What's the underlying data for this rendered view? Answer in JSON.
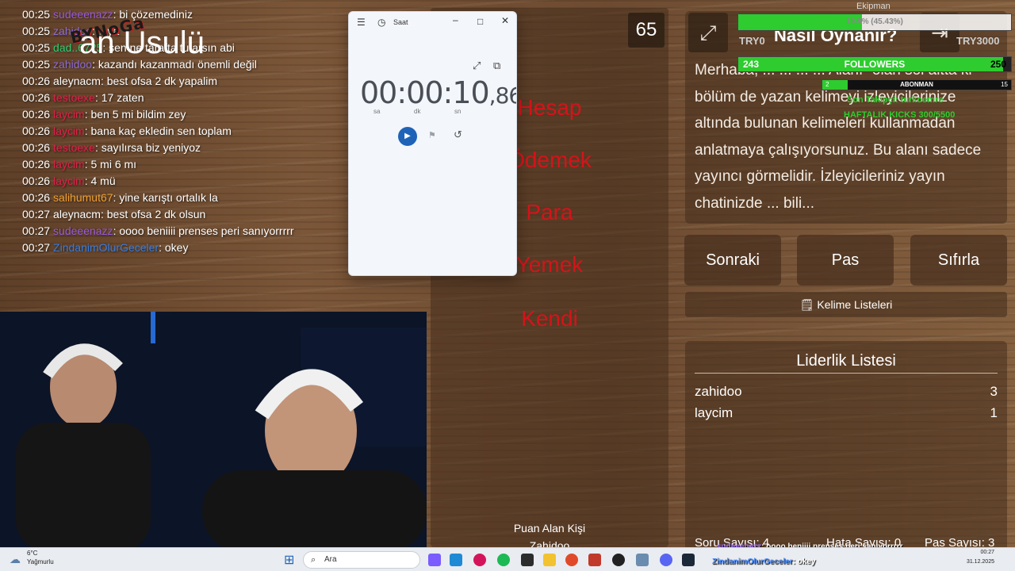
{
  "chat": {
    "messages": [
      {
        "time": "00:25",
        "user": "sudeeenazz",
        "color": "#9b59d9",
        "text": ": bi çözemediniz"
      },
      {
        "time": "00:25",
        "user": "zahidoo",
        "color": "#8e6bd6",
        "text": ": ...ya"
      },
      {
        "time": "00:25",
        "user": "dad..6725",
        "color": "#2ecc71",
        "text": ": sen ne tarafta tutarsın abi"
      },
      {
        "time": "00:25",
        "user": "zahidoo",
        "color": "#8e6bd6",
        "text": ": kazandı kazanmadı önemli değil"
      },
      {
        "time": "00:26",
        "user": "aleynacm",
        "color": "#ffffff",
        "text": ": best ofsa 2 dk yapalim"
      },
      {
        "time": "00:26",
        "user": "testoexe",
        "color": "#e0204a",
        "text": ": 17 zaten"
      },
      {
        "time": "00:26",
        "user": "laycim",
        "color": "#e0204a",
        "text": ": ben 5 mi bildim zey"
      },
      {
        "time": "00:26",
        "user": "laycim",
        "color": "#e0204a",
        "text": ": bana kaç ekledin sen toplam"
      },
      {
        "time": "00:26",
        "user": "testoexe",
        "color": "#e0204a",
        "text": ": sayılırsa biz yeniyoz"
      },
      {
        "time": "00:26",
        "user": "laycim",
        "color": "#e0204a",
        "text": ": 5 mi 6 mı"
      },
      {
        "time": "00:26",
        "user": "laycim",
        "color": "#e0204a",
        "text": ": 4 mü"
      },
      {
        "time": "00:26",
        "user": "salihumut67",
        "color": "#f0a030",
        "text": ": yine karıştı ortalık la"
      },
      {
        "time": "00:27",
        "user": "aleynacm",
        "color": "#ffffff",
        "text": ": best ofsa 2 dk olsun"
      },
      {
        "time": "00:27",
        "user": "sudeeenazz",
        "color": "#9b59d9",
        "text": ": oooo beniiii prenses peri sanıyorrrrr"
      },
      {
        "time": "00:27",
        "user": "ZindanimOlurGeceler",
        "color": "#3b7ddd",
        "text": ": okey"
      }
    ],
    "logo_text": "BYNoGa"
  },
  "clock_app": {
    "title": "Saat",
    "stopwatch_main": "00:00:10",
    "stopwatch_ms": ",86",
    "unit_hours": "sa",
    "unit_minutes": "dk",
    "unit_seconds": "sn"
  },
  "game": {
    "title": "an Usulü",
    "timer": "65",
    "forbidden_words": [
      "Hesap",
      "Ödemek",
      "Para",
      "Yemek",
      "Kendi"
    ],
    "last_scorer_label": "Puan Alan Kişi",
    "last_scorer_name": "Zahidoo"
  },
  "rules": {
    "title": "Nasıl Oynanır?",
    "text": "Merhaba, ... ... ... ... Alanı- olan sol altta ki bölüm de yazan kelimeyi izleyicilerinize altında bulunan kelimeleri kullanmadan anlatmaya çalışıyorsunuz. Bu alanı sadece yayıncı görmelidir. İzleyicileriniz yayın chatinizde ... bili..."
  },
  "controls": {
    "next": "Sonraki",
    "pass": "Pas",
    "reset": "Sıfırla",
    "word_lists": "Kelime Listeleri"
  },
  "leaderboard": {
    "title": "Liderlik Listesi",
    "rows": [
      {
        "name": "zahidoo",
        "score": "3"
      },
      {
        "name": "laycim",
        "score": "1"
      }
    ]
  },
  "stats": {
    "correct": "Soru Sayısı: 4",
    "wrong": "Hata Sayısı: 0",
    "passes": "Pas Sayısı: 3"
  },
  "overlay": {
    "goal_label": "Ekipman",
    "goal_progress_text": "10.9% (45.43%)",
    "goal_percent": 45.43,
    "followers_label": "FOLLOWERS",
    "followers_current": "243",
    "followers_target": "250",
    "followers_fraction": 0.972,
    "subs_label": "ABONMAN",
    "subs_current": "2",
    "subs_target": "15",
    "subs_fraction": 0.133,
    "last_follower": "Son Takipçi: turkoemre",
    "weekly_kicks": "HAFTALIK KICKS 300/5500",
    "currency_left": "TRY0",
    "currency_right": "TRY3000"
  },
  "bottom_chat": [
    {
      "user": "sudeeenazz",
      "text": ": oooo beniiii prenses peri sanıyorrrrr"
    },
    {
      "user": "ZindanimOlurGeceler",
      "text": ": okey"
    }
  ],
  "taskbar": {
    "weather_temp": "6°C",
    "weather_cond": "Yağmurlu",
    "search_placeholder": "Ara",
    "time": "00:27",
    "date": "31.12.2025"
  },
  "colors": {
    "forbidden": "#d4141a",
    "bar_green": "#2ecc2e",
    "accent_blue": "#1f63b8"
  }
}
